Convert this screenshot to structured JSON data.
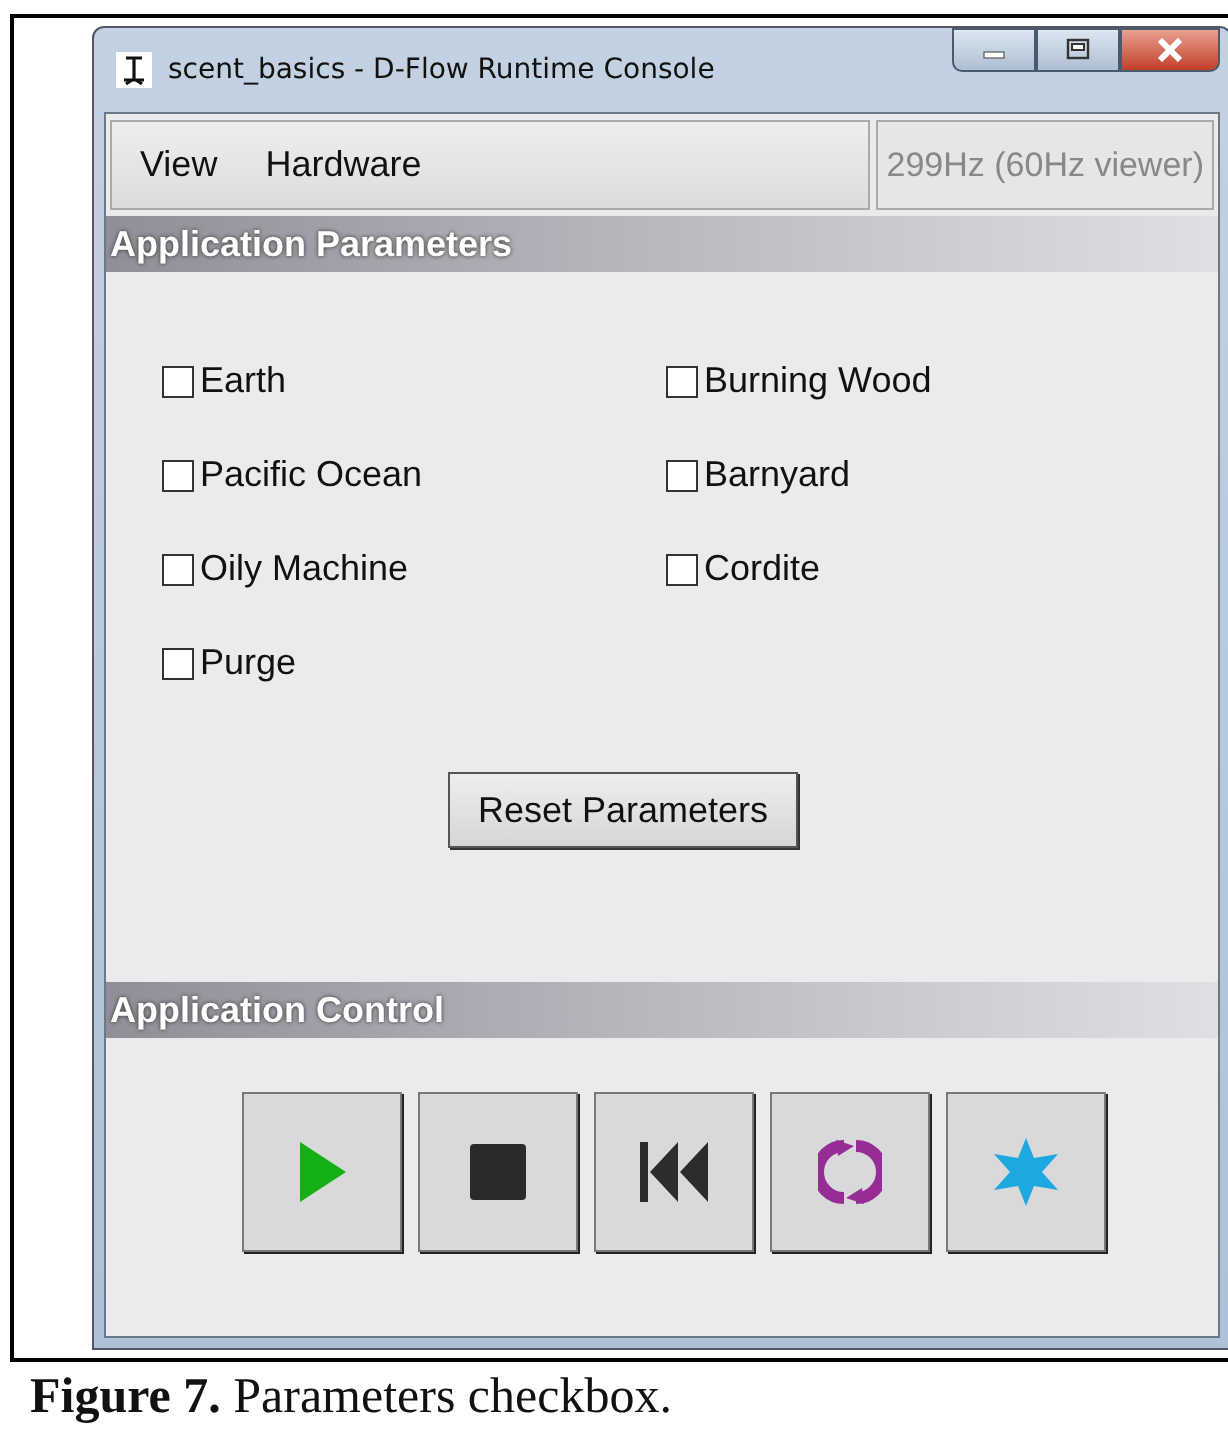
{
  "window": {
    "title": "scent_basics - D-Flow Runtime Console"
  },
  "menu": [
    "View",
    "Hardware"
  ],
  "status": "299Hz (60Hz viewer)",
  "parameters": {
    "header": "Application Parameters",
    "checkboxes": [
      {
        "label": "Earth",
        "checked": false
      },
      {
        "label": "Burning Wood",
        "checked": false
      },
      {
        "label": "Pacific Ocean",
        "checked": false
      },
      {
        "label": "Barnyard",
        "checked": false
      },
      {
        "label": "Oily Machine",
        "checked": false
      },
      {
        "label": "Cordite",
        "checked": false
      },
      {
        "label": "Purge",
        "checked": false
      }
    ],
    "reset_button": "Reset Parameters"
  },
  "control": {
    "header": "Application Control",
    "buttons": [
      {
        "kind": "play"
      },
      {
        "kind": "stop"
      },
      {
        "kind": "rewind"
      },
      {
        "kind": "reload"
      },
      {
        "kind": "star"
      }
    ]
  },
  "caption": {
    "label": "Figure 7.",
    "text": "Parameters checkbox."
  }
}
